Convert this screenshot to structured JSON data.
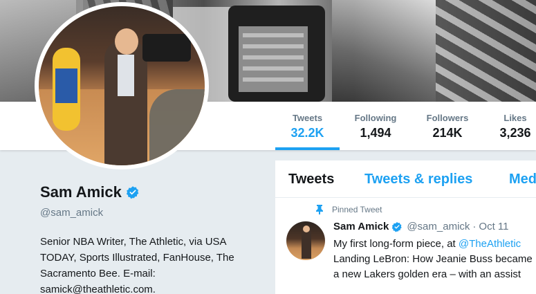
{
  "profile": {
    "name": "Sam Amick",
    "handle": "@sam_amick",
    "bio_lines": [
      "Senior NBA Writer, The Athletic, via USA",
      "TODAY, Sports Illustrated, FanHouse, The",
      "Sacramento Bee. E-mail:",
      "samick@theathletic.com."
    ]
  },
  "stats": {
    "tweets": {
      "label": "Tweets",
      "value": "32.2K"
    },
    "following": {
      "label": "Following",
      "value": "1,494"
    },
    "followers": {
      "label": "Followers",
      "value": "214K"
    },
    "likes": {
      "label": "Likes",
      "value": "3,236"
    }
  },
  "tabs": {
    "tweets": "Tweets",
    "replies": "Tweets & replies",
    "media": "Media"
  },
  "pinned_tweet": {
    "pinned_label": "Pinned Tweet",
    "author_name": "Sam Amick",
    "author_handle": "@sam_amick",
    "separator": "·",
    "date": "Oct 11",
    "text_line1_prefix": "My first long-form piece, at ",
    "text_line1_mention": "@TheAthletic",
    "text_line2": "Landing LeBron: How Jeanie Buss became",
    "text_line3": "a new Lakers golden era – with an assist"
  },
  "colors": {
    "accent": "#1da1f2",
    "muted": "#657786",
    "text": "#14171a",
    "background": "#e6ecf0"
  },
  "icons": {
    "verified": "verified-badge-icon",
    "pin": "pin-icon"
  }
}
